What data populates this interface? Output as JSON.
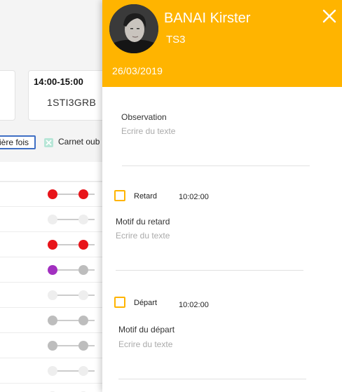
{
  "background": {
    "slot": {
      "time": "14:00-15:00",
      "class_name": "1STI3GRB"
    },
    "filters": {
      "chip_label": "ière fois",
      "carnet_label": "Carnet oub"
    },
    "attendance_rows": [
      {
        "dot1": "#e8141a",
        "dot2": "#e8141a"
      },
      {
        "dot1": "#eeeeee",
        "dot2": "#eeeeee"
      },
      {
        "dot1": "#e8141a",
        "dot2": "#e8141a"
      },
      {
        "dot1": "#a230c0",
        "dot2": "#bdbdbd"
      },
      {
        "dot1": "#eeeeee",
        "dot2": "#eeeeee"
      },
      {
        "dot1": "#bdbdbd",
        "dot2": "#bdbdbd"
      },
      {
        "dot1": "#bdbdbd",
        "dot2": "#bdbdbd"
      },
      {
        "dot1": "#eeeeee",
        "dot2": "#eeeeee"
      },
      {
        "dot1": "#eeeeee",
        "dot2": "#eeeeee"
      }
    ]
  },
  "panel": {
    "accent_color": "#ffb400",
    "student_name": "BANAI Kirster",
    "student_class": "TS3",
    "date": "26/03/2019",
    "close_icon": "close-icon",
    "observation": {
      "label": "Observation",
      "placeholder": "Ecrire du texte",
      "value": ""
    },
    "retard": {
      "label": "Retard",
      "time": "10:02:00",
      "checked": false
    },
    "motif_retard": {
      "label": "Motif du retard",
      "placeholder": "Ecrire du texte",
      "value": ""
    },
    "depart": {
      "label": "Départ",
      "time": "10:02:00",
      "checked": false
    },
    "motif_depart": {
      "label": "Motif du départ",
      "placeholder": "Ecrire du texte",
      "value": ""
    }
  }
}
